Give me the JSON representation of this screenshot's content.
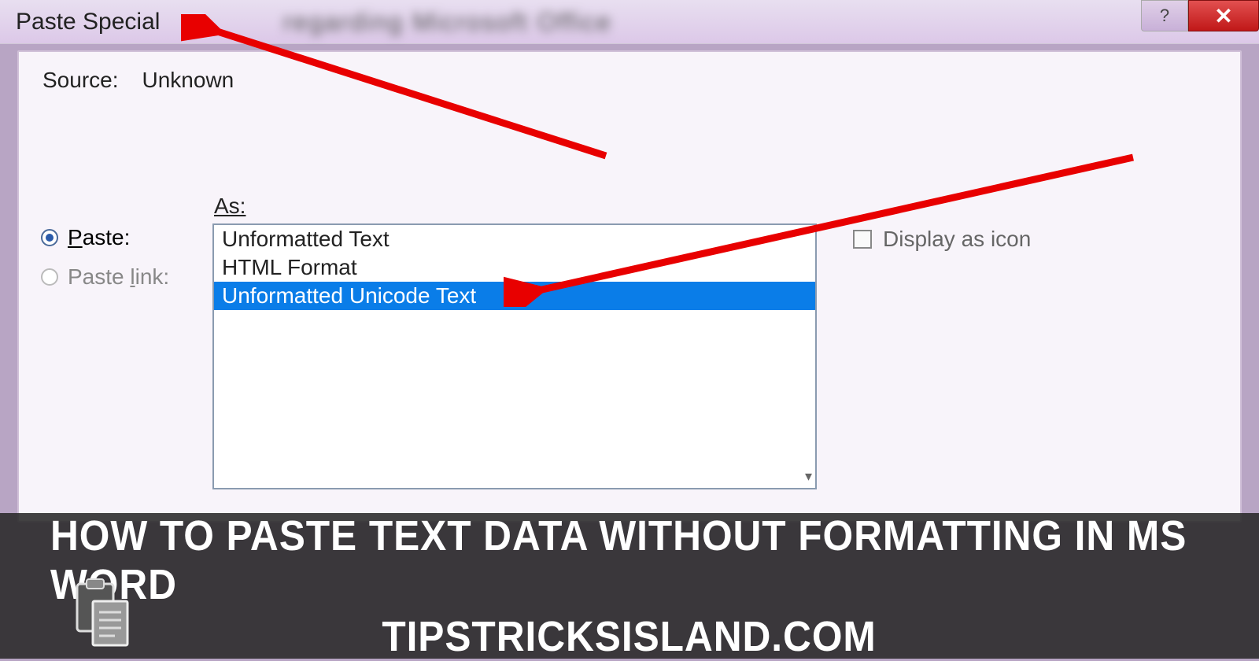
{
  "dialog": {
    "title": "Paste Special",
    "source_label": "Source:",
    "source_value": "Unknown",
    "as_label": "As:",
    "radios": {
      "paste": "Paste:",
      "paste_link": "Paste link:",
      "paste_underline_char": "P",
      "link_underline_char": "l"
    },
    "list_items": [
      "Unformatted Text",
      "HTML Format",
      "Unformatted Unicode Text"
    ],
    "selected_index": 2,
    "display_as_icon": "Display as icon",
    "help_label": "?",
    "close_label": "✕"
  },
  "banner": {
    "line1": "HOW TO PASTE TEXT DATA WITHOUT FORMATTING IN MS WORD",
    "line2": "TIPSTRICKSISLAND.COM"
  },
  "blur_bg_text": "regarding Microsoft Office"
}
